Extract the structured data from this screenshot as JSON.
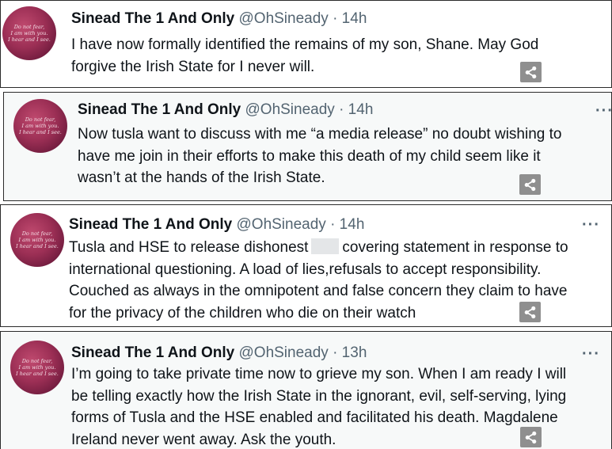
{
  "tweets": [
    {
      "name": "Sinead The 1 And Only",
      "handle": "@OhSineady · 14h",
      "more": "",
      "lines": [
        "I have now formally identified the remains of my son, Shane.  May God",
        "forgive the Irish State for I never will."
      ]
    },
    {
      "name": "Sinead The 1 And Only",
      "handle": "@OhSineady · 14h",
      "more": "···",
      "lines": [
        "Now tusla want to discuss with me “a media release” no doubt wishing to",
        "have me join in their efforts to make this death of my child seem like it",
        "wasn’t at the hands of the Irish State."
      ]
    },
    {
      "name": "Sinead The 1 And Only",
      "handle": "@OhSineady · 14h",
      "more": "···",
      "line1_a": "Tusla and HSE to release dishonest",
      "line1_b": "covering statement in response to",
      "lines": [
        "international questioning.  A load of lies,refusals to accept responsibility.",
        "Couched as always in the omnipotent and false concern they claim to have",
        "for the privacy of the children who die on their watch"
      ]
    },
    {
      "name": "Sinead The 1 And Only",
      "handle": "@OhSineady · 13h",
      "more": "···",
      "lines": [
        "I’m going to take private time now to grieve my son.  When I am ready I will",
        "be telling exactly how the Irish State in the ignorant, evil, self-serving, lying",
        "forms of Tusla and the HSE enabled and facilitated his death.  Magdalene",
        "Ireland never went away. Ask the youth."
      ]
    }
  ],
  "avatar": {
    "quote_lines": [
      "Do not fear,",
      "I am with you.",
      "I hear and I see."
    ],
    "colors": {
      "outer": "#6e1b3d",
      "inner": "#c04a6f"
    }
  },
  "icons": {
    "share": "share-icon",
    "more": "more-options-icon"
  },
  "colors": {
    "text": "#0f1419",
    "secondary": "#536471",
    "share_bg": "#8f8f8f"
  }
}
